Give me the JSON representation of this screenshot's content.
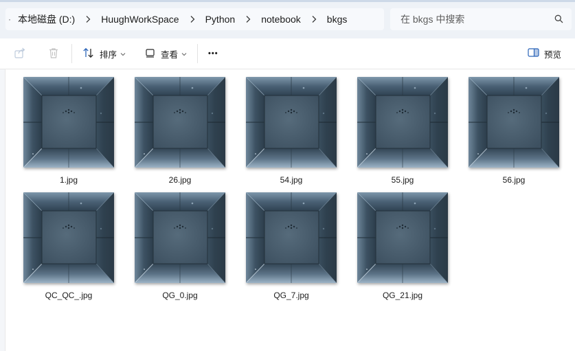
{
  "address_bar": {
    "breadcrumb": [
      "本地磁盘 (D:)",
      "HuughWorkSpace",
      "Python",
      "notebook",
      "bkgs"
    ],
    "search_placeholder": "在 bkgs 中搜索"
  },
  "toolbar": {
    "sort_label": "排序",
    "view_label": "查看",
    "more_label": "•••",
    "preview_label": "预览"
  },
  "files": [
    {
      "name": "1.jpg"
    },
    {
      "name": "26.jpg"
    },
    {
      "name": "54.jpg"
    },
    {
      "name": "55.jpg"
    },
    {
      "name": "56.jpg"
    },
    {
      "name": "QC_QC_.jpg"
    },
    {
      "name": "QG_0.jpg"
    },
    {
      "name": "QG_7.jpg"
    },
    {
      "name": "QG_21.jpg"
    }
  ],
  "icons": {
    "share": "share-icon",
    "delete": "trash-icon",
    "sort": "sort-icon",
    "view": "view-icon",
    "preview": "preview-pane-icon",
    "search": "search-icon",
    "chevron": "chevron-right-icon"
  }
}
